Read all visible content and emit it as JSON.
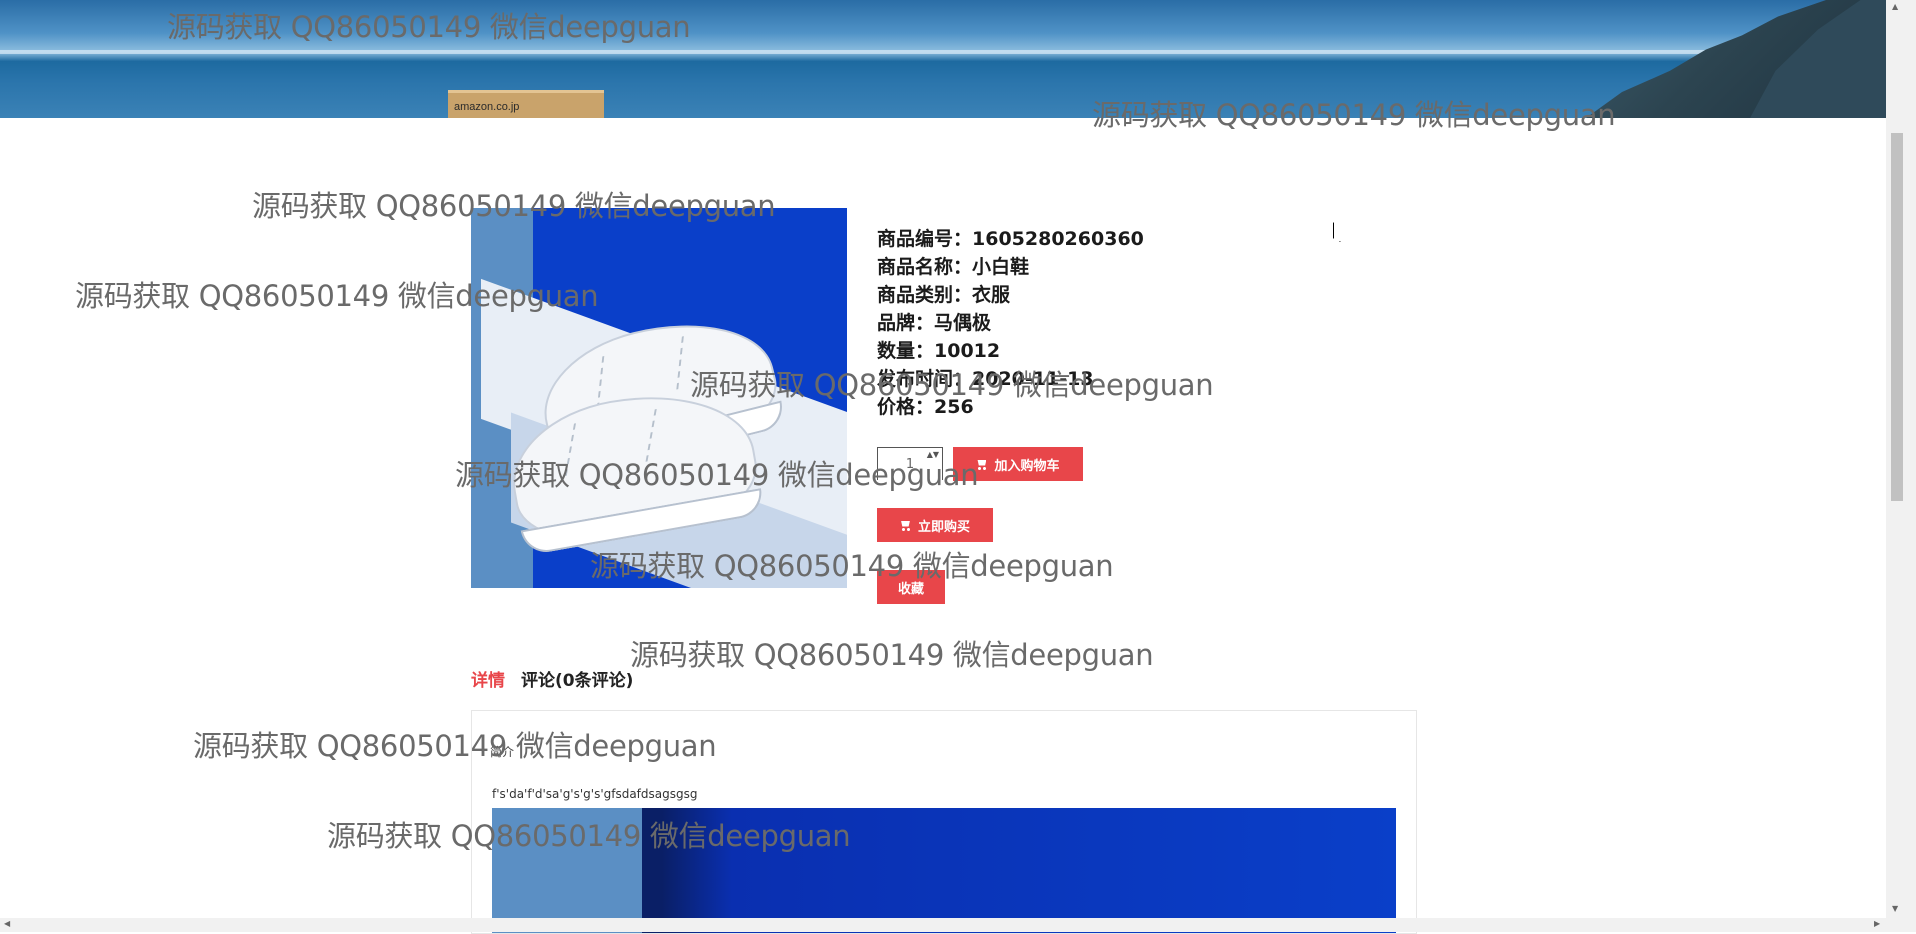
{
  "banner": {
    "box_label": "amazon.co.jp"
  },
  "product": {
    "lines": [
      {
        "label": "商品编号：",
        "value": "1605280260360"
      },
      {
        "label": "商品名称：",
        "value": "小白鞋"
      },
      {
        "label": "商品类别：",
        "value": "衣服"
      },
      {
        "label": "品牌：",
        "value": "马偶极"
      },
      {
        "label": "数量：",
        "value": "10012"
      },
      {
        "label": "发布时间：",
        "value": "2020-11-13"
      },
      {
        "label": "价格：",
        "value": "256"
      }
    ],
    "quantity_value": "1",
    "quantity_spin": "▲▼"
  },
  "actions": {
    "add_to_cart": "加入购物车",
    "buy_now": "立即购买",
    "favorite": "收藏",
    "cart_icon": "cart-icon"
  },
  "tabs": {
    "details": "详情",
    "comments": "评论(0条评论)"
  },
  "detail": {
    "label": "简介",
    "text": "f's'da'f'd'sa'g's'g's'gfsdafdsagsgsg"
  },
  "scrollbars": {
    "up": "▲",
    "down": "▼",
    "left": "◀",
    "right": "▶"
  },
  "watermark": "源码获取 QQ86050149 微信deepguan",
  "colors": {
    "accent": "#e8464a",
    "active_tab": "#e8464a"
  }
}
